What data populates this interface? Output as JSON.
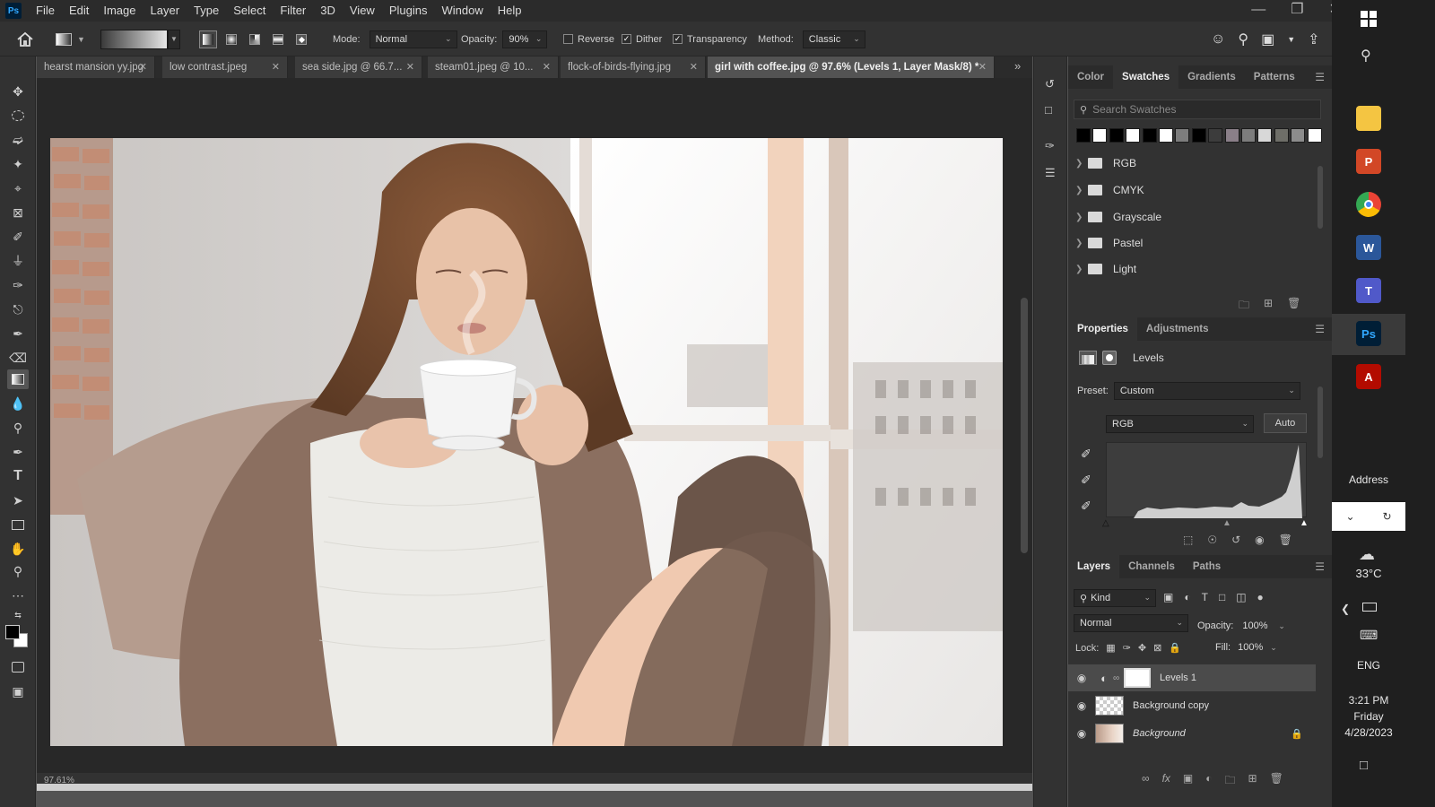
{
  "menubar": {
    "logo": "Ps",
    "items": [
      "File",
      "Edit",
      "Image",
      "Layer",
      "Type",
      "Select",
      "Filter",
      "3D",
      "View",
      "Plugins",
      "Window",
      "Help"
    ]
  },
  "optionsbar": {
    "mode_label": "Mode:",
    "mode_value": "Normal",
    "opacity_label": "Opacity:",
    "opacity_value": "90%",
    "reverse_label": "Reverse",
    "dither_label": "Dither",
    "transparency_label": "Transparency",
    "method_label": "Method:",
    "method_value": "Classic"
  },
  "tabs": [
    {
      "label": "hearst mansion yy.jpg"
    },
    {
      "label": "low contrast.jpeg"
    },
    {
      "label": "sea side.jpg @ 66.7..."
    },
    {
      "label": "steam01.jpeg @ 10..."
    },
    {
      "label": "flock-of-birds-flying.jpg"
    },
    {
      "label": "girl with coffee.jpg @ 97.6% (Levels 1, Layer Mask/8) *"
    }
  ],
  "status": {
    "zoom": "97.61%"
  },
  "swatches_panel": {
    "tabs": [
      "Color",
      "Swatches",
      "Gradients",
      "Patterns"
    ],
    "active_tab": "Swatches",
    "search_placeholder": "Search Swatches",
    "colors": [
      "#000000",
      "#ffffff",
      "#000000",
      "#ffffff",
      "#000000",
      "#ffffff",
      "#7d7d7d",
      "#000000",
      "#3c3c3c",
      "#8a7f88",
      "#7d7d7d",
      "#d8d8d8",
      "#6e6e68",
      "#8c8c8c",
      "#ffffff"
    ],
    "folders": [
      "RGB",
      "CMYK",
      "Grayscale",
      "Pastel",
      "Light"
    ]
  },
  "properties_panel": {
    "tabs": [
      "Properties",
      "Adjustments"
    ],
    "title": "Levels",
    "preset_label": "Preset:",
    "preset_value": "Custom",
    "channel_value": "RGB",
    "auto_label": "Auto"
  },
  "layers_panel": {
    "tabs": [
      "Layers",
      "Channels",
      "Paths"
    ],
    "kind_label": "Kind",
    "blend_mode": "Normal",
    "opacity_label": "Opacity:",
    "opacity_value": "100%",
    "lock_label": "Lock:",
    "fill_label": "Fill:",
    "fill_value": "100%",
    "layers": [
      {
        "name": "Levels 1"
      },
      {
        "name": "Background copy"
      },
      {
        "name": "Background"
      }
    ]
  },
  "taskbar": {
    "address_label": "Address",
    "temperature": "33°C",
    "language": "ENG",
    "time": "3:21 PM",
    "day": "Friday",
    "date": "4/28/2023",
    "apps": [
      "File Explorer",
      "PowerPoint",
      "Chrome",
      "Word",
      "Teams",
      "Photoshop",
      "Acrobat"
    ]
  },
  "colors": {
    "ps_blue": "#31a8ff",
    "panel_bg": "#323232",
    "canvas_bg": "#282828"
  }
}
